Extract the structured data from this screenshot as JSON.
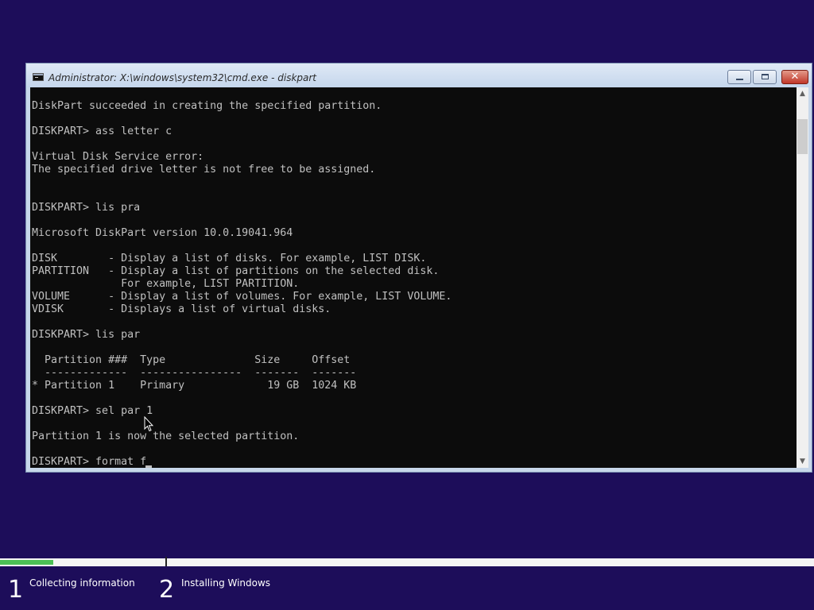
{
  "window": {
    "title": "Administrator: X:\\windows\\system32\\cmd.exe - diskpart",
    "icon": "console-icon",
    "controls": {
      "minimize": "minimize-icon",
      "maximize": "maximize-icon",
      "close": "✕"
    }
  },
  "console": {
    "lines": [
      "DiskPart succeeded in creating the specified partition.",
      "",
      "DISKPART> ass letter c",
      "",
      "Virtual Disk Service error:",
      "The specified drive letter is not free to be assigned.",
      "",
      "",
      "DISKPART> lis pra",
      "",
      "Microsoft DiskPart version 10.0.19041.964",
      "",
      "DISK        - Display a list of disks. For example, LIST DISK.",
      "PARTITION   - Display a list of partitions on the selected disk.",
      "              For example, LIST PARTITION.",
      "VOLUME      - Display a list of volumes. For example, LIST VOLUME.",
      "VDISK       - Displays a list of virtual disks.",
      "",
      "DISKPART> lis par",
      "",
      "  Partition ###  Type              Size     Offset",
      "  -------------  ----------------  -------  -------",
      "* Partition 1    Primary             19 GB  1024 KB",
      "",
      "DISKPART> sel par 1",
      "",
      "Partition 1 is now the selected partition.",
      "",
      "DISKPART> format f"
    ],
    "colors": {
      "background": "#0c0c0c",
      "text": "#c0c0c0"
    }
  },
  "scrollbar": {
    "up": "▲",
    "down": "▼"
  },
  "setup": {
    "progress": 0.065,
    "accent": "#4cc055",
    "background": "#1d0d5a",
    "steps": [
      {
        "number": "1",
        "label": "Collecting information"
      },
      {
        "number": "2",
        "label": "Installing Windows"
      }
    ]
  }
}
